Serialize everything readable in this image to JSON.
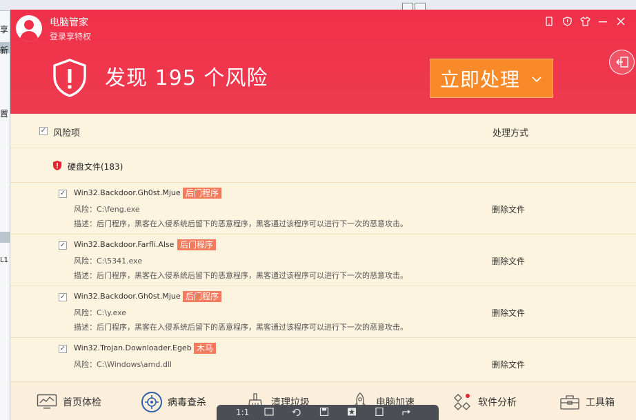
{
  "background": {
    "sidebar_fragments": [
      "享",
      "新",
      "置",
      "L1"
    ]
  },
  "app": {
    "brand": "电脑管家",
    "login_link": "登录享特权",
    "top_icons": [
      "phone-icon",
      "shield-icon",
      "shirt-icon",
      "minimize-icon",
      "close-icon"
    ],
    "risk_title": "发现 195 个风险",
    "action_button": "立即处理",
    "header_color": "#f0304a",
    "accent_orange": "#f98a2a"
  },
  "columns": {
    "risk_item": "风险项",
    "handling": "处理方式"
  },
  "group": {
    "label": "硬盘文件(183)"
  },
  "rows": [
    {
      "name": "Win32.Backdoor.Gh0st.Mjue",
      "tag": "后门程序",
      "path": "风险：C:\\feng.exe",
      "desc": "描述：后门程序，黑客在入侵系统后留下的恶意程序，黑客通过该程序可以进行下一次的恶意攻击。",
      "action": "删除文件"
    },
    {
      "name": "Win32.Backdoor.Farfli.Alse",
      "tag": "后门程序",
      "path": "风险：C:\\5341.exe",
      "desc": "描述：后门程序，黑客在入侵系统后留下的恶意程序，黑客通过该程序可以进行下一次的恶意攻击。",
      "action": "删除文件"
    },
    {
      "name": "Win32.Backdoor.Gh0st.Mjue",
      "tag": "后门程序",
      "path": "风险：C:\\y.exe",
      "desc": "描述：后门程序，黑客在入侵系统后留下的恶意程序，黑客通过该程序可以进行下一次的恶意攻击。",
      "action": "删除文件"
    },
    {
      "name": "Win32.Trojan.Downloader.Egeb",
      "tag": "木马",
      "path": "风险：C:\\Windows\\amd.dll",
      "desc": "",
      "action": "删除文件"
    }
  ],
  "nav": [
    {
      "label": "首页体检",
      "icon": "monitor-chart-icon"
    },
    {
      "label": "病毒查杀",
      "icon": "crosshair-icon"
    },
    {
      "label": "清理垃圾",
      "icon": "broom-icon"
    },
    {
      "label": "电脑加速",
      "icon": "rocket-icon"
    },
    {
      "label": "软件分析",
      "icon": "apps-icon"
    },
    {
      "label": "工具箱",
      "icon": "toolbox-icon"
    }
  ],
  "overlay_toolbar": {
    "zoom": "1:1"
  }
}
